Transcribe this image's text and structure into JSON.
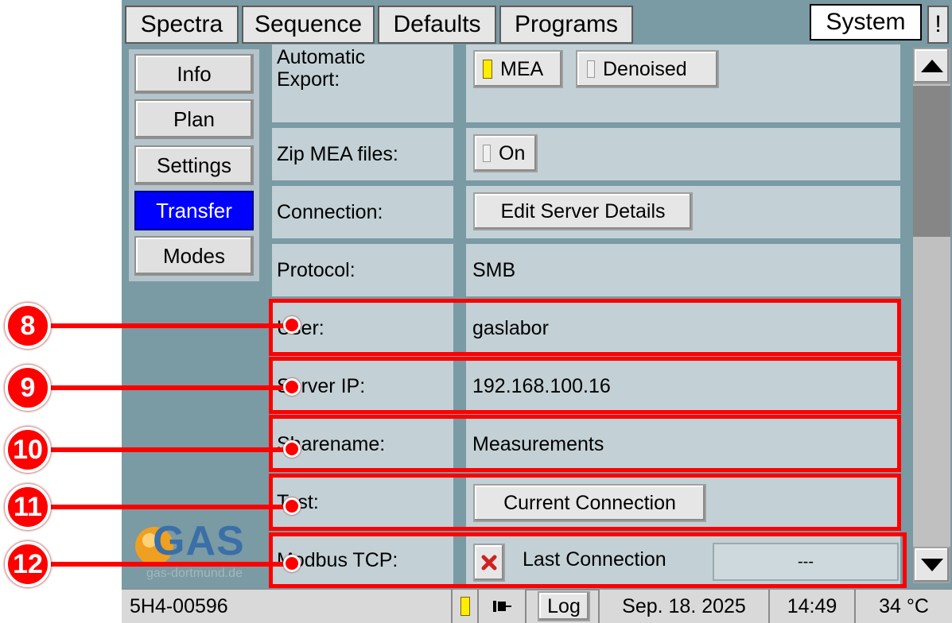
{
  "tabs": [
    {
      "label": "Spectra"
    },
    {
      "label": "Sequence"
    },
    {
      "label": "Defaults"
    },
    {
      "label": "Programs"
    },
    {
      "label": "System"
    },
    {
      "label": "!"
    }
  ],
  "sidebar": {
    "items": [
      {
        "label": "Info"
      },
      {
        "label": "Plan"
      },
      {
        "label": "Settings"
      },
      {
        "label": "Transfer"
      },
      {
        "label": "Modes"
      }
    ]
  },
  "logo": {
    "brand": "GAS",
    "url": "gas-dortmund.de"
  },
  "rows": {
    "export_label": "Automatic Export:",
    "export_mea": "MEA",
    "export_denoised": "Denoised",
    "zip_label": "Zip MEA files:",
    "zip_on": "On",
    "connection_label": "Connection:",
    "edit_server": "Edit Server Details",
    "protocol_label": "Protocol:",
    "protocol_value": "SMB",
    "user_label": "User:",
    "user_value": "gaslabor",
    "server_ip_label": "Server IP:",
    "server_ip_value": "192.168.100.16",
    "sharename_label": "Sharename:",
    "sharename_value": "Measurements",
    "test_label": "Test:",
    "current_connection": "Current Connection",
    "modbus_label": "Modbus TCP:",
    "last_connection": "Last Connection",
    "last_connection_value": "---"
  },
  "callouts": [
    "8",
    "9",
    "10",
    "11",
    "12"
  ],
  "statusbar": {
    "device_id": "5H4-00596",
    "log": "Log",
    "date": "Sep. 18. 2025",
    "time": "14:49",
    "temperature": "34 °C"
  },
  "colors": {
    "accent_selected": "#0000ff",
    "highlight": "#ff0000",
    "indicator_on": "#ffee00",
    "brand_orange": "#f0a020",
    "brand_blue": "#3a6fa8"
  }
}
